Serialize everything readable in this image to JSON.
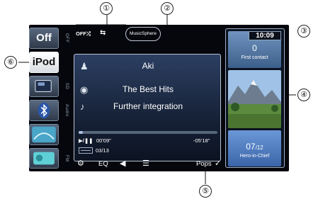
{
  "callouts": [
    "①",
    "②",
    "③",
    "④",
    "⑤",
    "⑥"
  ],
  "sources": [
    {
      "label": "Off",
      "side": "OFF"
    },
    {
      "label": "iPod",
      "side": ""
    },
    {
      "label": "",
      "side": "SD"
    },
    {
      "label": "",
      "side": "Audio"
    },
    {
      "label": "",
      "side": ""
    },
    {
      "label": "",
      "side": "FM"
    }
  ],
  "status": {
    "shuffle": "OFF⤮",
    "repeat": "⇆",
    "logo": "MusicSphere"
  },
  "track": {
    "artist": "Aki",
    "album": "The Best Hits",
    "title": "Further integration",
    "elapsed": "00'09\"",
    "remaining": "-05'18\"",
    "count": "03/13",
    "progress_fraction": 0.03
  },
  "controls": {
    "eq": "EQ",
    "genre": "Pops"
  },
  "clock": "10:09",
  "right": {
    "top_number": "0",
    "top_title": "First contact",
    "bottom_number": "07",
    "bottom_total": "/12",
    "bottom_title": "Hero-in-Chief"
  },
  "colors": {
    "screen_bg": "#05070d",
    "panel_border": "#b8c2d0",
    "accent_blue": "#3a64a8"
  }
}
